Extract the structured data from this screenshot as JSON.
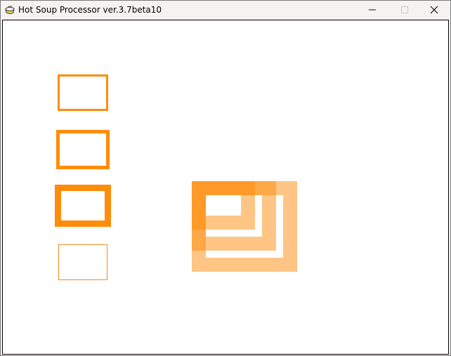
{
  "window": {
    "title": "Hot Soup Processor ver.3.7beta10",
    "app_icon": "hsp-soup-icon",
    "controls": {
      "minimize_icon": "minimize-icon",
      "maximize_icon": "maximize-icon",
      "close_icon": "close-icon"
    }
  },
  "canvas": {
    "background": "#ffffff",
    "shape_color": "#ff8c0a",
    "thin_shape_color": "#ef8b22"
  }
}
